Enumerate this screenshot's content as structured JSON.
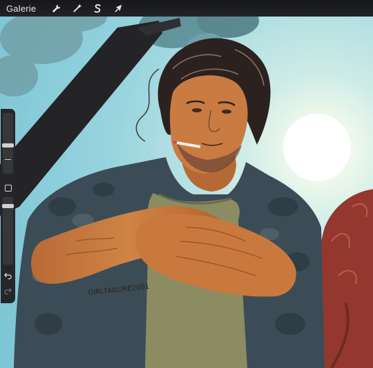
{
  "topbar": {
    "gallery_label": "Galerie",
    "tools": [
      {
        "name": "actions",
        "icon": "wrench-icon"
      },
      {
        "name": "adjustments",
        "icon": "magic-wand-icon"
      },
      {
        "name": "selection",
        "icon": "selection-s-icon"
      },
      {
        "name": "transform",
        "icon": "arrow-cursor-icon"
      }
    ]
  },
  "sidebar": {
    "brush_size_level": 0.55,
    "opacity_level": 0.6,
    "icons": [
      "minus-icon",
      "square-icon",
      "undo-icon",
      "redo-icon"
    ]
  },
  "canvas": {
    "signature": "GIRLFAILURE2001",
    "colors": {
      "sky_top": "#9fd7df",
      "sky_light": "#dff4f2",
      "sun": "#ffffff",
      "skin": "#c8743a",
      "shirt": "#3c4c57",
      "tshirt": "#8b8c62",
      "hair": "#2b2220",
      "branch": "#242326",
      "red_shirt": "#94382f"
    }
  }
}
